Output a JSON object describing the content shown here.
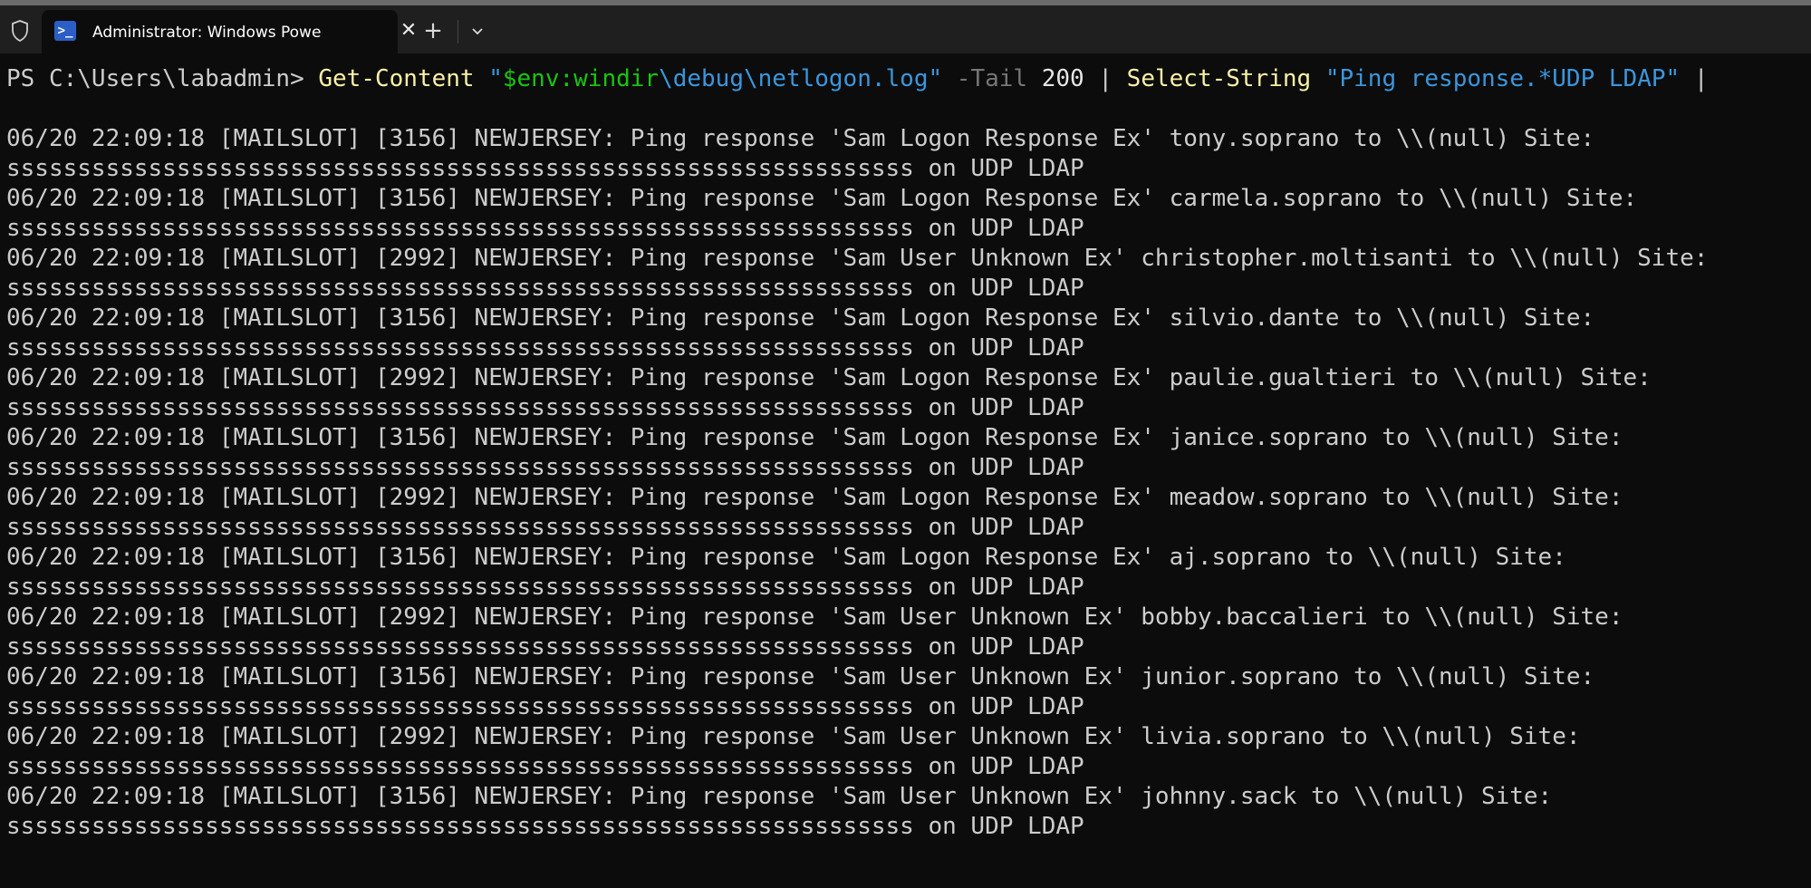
{
  "titlebar": {
    "tab_title": "Administrator: Windows Powe",
    "tab_icon_glyph": ">_",
    "close_glyph": "✕",
    "new_tab_glyph": "+",
    "icons": [
      "shield-icon",
      "powershell-icon",
      "close-icon",
      "plus-icon",
      "chevron-down-icon"
    ]
  },
  "prompt": {
    "ps_prefix": "PS C:\\Users\\labadmin> ",
    "cmdlet1": "Get-Content",
    "path_open_quote": "\"",
    "path_var": "$env:windir",
    "path_rest": "\\debug\\netlogon.log\"",
    "param_tail": "-Tail",
    "tail_value": "200",
    "pipe": "|",
    "cmdlet2": "Select-String",
    "pattern": "\"Ping response.*UDP LDAP\"",
    "trailing_pipe": "|"
  },
  "output": [
    {
      "line1": "06/20 22:09:18 [MAILSLOT] [3156] NEWJERSEY: Ping response 'Sam Logon Response Ex' tony.soprano to \\\\(null) Site:",
      "line2": "ssssssssssssssssssssssssssssssssssssssssssssssssssssssssssssssss on UDP LDAP"
    },
    {
      "line1": "06/20 22:09:18 [MAILSLOT] [3156] NEWJERSEY: Ping response 'Sam Logon Response Ex' carmela.soprano to \\\\(null) Site:",
      "line2": "ssssssssssssssssssssssssssssssssssssssssssssssssssssssssssssssss on UDP LDAP"
    },
    {
      "line1": "06/20 22:09:18 [MAILSLOT] [2992] NEWJERSEY: Ping response 'Sam User Unknown Ex' christopher.moltisanti to \\\\(null) Site:",
      "line2": "ssssssssssssssssssssssssssssssssssssssssssssssssssssssssssssssss on UDP LDAP"
    },
    {
      "line1": "06/20 22:09:18 [MAILSLOT] [3156] NEWJERSEY: Ping response 'Sam Logon Response Ex' silvio.dante to \\\\(null) Site:",
      "line2": "ssssssssssssssssssssssssssssssssssssssssssssssssssssssssssssssss on UDP LDAP"
    },
    {
      "line1": "06/20 22:09:18 [MAILSLOT] [2992] NEWJERSEY: Ping response 'Sam Logon Response Ex' paulie.gualtieri to \\\\(null) Site:",
      "line2": "ssssssssssssssssssssssssssssssssssssssssssssssssssssssssssssssss on UDP LDAP"
    },
    {
      "line1": "06/20 22:09:18 [MAILSLOT] [3156] NEWJERSEY: Ping response 'Sam Logon Response Ex' janice.soprano to \\\\(null) Site:",
      "line2": "ssssssssssssssssssssssssssssssssssssssssssssssssssssssssssssssss on UDP LDAP"
    },
    {
      "line1": "06/20 22:09:18 [MAILSLOT] [2992] NEWJERSEY: Ping response 'Sam Logon Response Ex' meadow.soprano to \\\\(null) Site:",
      "line2": "ssssssssssssssssssssssssssssssssssssssssssssssssssssssssssssssss on UDP LDAP"
    },
    {
      "line1": "06/20 22:09:18 [MAILSLOT] [3156] NEWJERSEY: Ping response 'Sam Logon Response Ex' aj.soprano to \\\\(null) Site:",
      "line2": "ssssssssssssssssssssssssssssssssssssssssssssssssssssssssssssssss on UDP LDAP"
    },
    {
      "line1": "06/20 22:09:18 [MAILSLOT] [2992] NEWJERSEY: Ping response 'Sam User Unknown Ex' bobby.baccalieri to \\\\(null) Site:",
      "line2": "ssssssssssssssssssssssssssssssssssssssssssssssssssssssssssssssss on UDP LDAP"
    },
    {
      "line1": "06/20 22:09:18 [MAILSLOT] [3156] NEWJERSEY: Ping response 'Sam User Unknown Ex' junior.soprano to \\\\(null) Site:",
      "line2": "ssssssssssssssssssssssssssssssssssssssssssssssssssssssssssssssss on UDP LDAP"
    },
    {
      "line1": "06/20 22:09:18 [MAILSLOT] [2992] NEWJERSEY: Ping response 'Sam User Unknown Ex' livia.soprano to \\\\(null) Site:",
      "line2": "ssssssssssssssssssssssssssssssssssssssssssssssssssssssssssssssss on UDP LDAP"
    },
    {
      "line1": "06/20 22:09:18 [MAILSLOT] [3156] NEWJERSEY: Ping response 'Sam User Unknown Ex' johnny.sack to \\\\(null) Site:",
      "line2": "ssssssssssssssssssssssssssssssssssssssssssssssssssssssssssssssss on UDP LDAP"
    }
  ],
  "colors": {
    "background": "#0c0c0c",
    "text": "#cccccc",
    "cmdlet": "#f9f1a5",
    "string": "#3a96dd",
    "parameter": "#767676",
    "variable": "#16c60c",
    "tab_icon": "#2b5fc7"
  }
}
